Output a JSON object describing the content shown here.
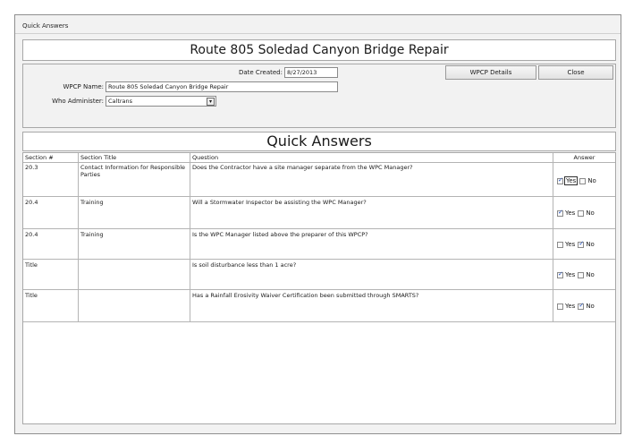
{
  "window": {
    "title": "Quick Answers"
  },
  "header": {
    "project_title": "Route 805 Soledad Canyon Bridge Repair"
  },
  "form": {
    "date_created_label": "Date Created:",
    "date_created_value": "8/27/2013",
    "wpcp_name_label": "WPCP Name:",
    "wpcp_name_value": "Route 805 Soledad Canyon Bridge Repair",
    "who_administer_label": "Who Administer:",
    "who_administer_value": "Caltrans",
    "wpcp_details_button": "WPCP Details",
    "close_button": "Close"
  },
  "section_title": "Quick Answers",
  "table": {
    "headers": {
      "section": "Section #",
      "title": "Section Title",
      "question": "Question",
      "answer": "Answer"
    },
    "yes_label": "Yes",
    "no_label": "No",
    "rows": [
      {
        "section": "20.3",
        "title": "Contact Information for Responsible Parties",
        "question": "Does the Contractor have a site manager separate from the WPC Manager?",
        "yes": true,
        "no": false
      },
      {
        "section": "20.4",
        "title": "Training",
        "question": "Will a Stormwater Inspector be assisting the WPC Manager?",
        "yes": true,
        "no": false
      },
      {
        "section": "20.4",
        "title": "Training",
        "question": "Is the WPC Manager listed above the preparer of this WPCP?",
        "yes": false,
        "no": true
      },
      {
        "section": "Title",
        "title": "",
        "question": "Is soil disturbance less than 1 acre?",
        "yes": true,
        "no": false
      },
      {
        "section": "Title",
        "title": "",
        "question": "Has a Rainfall Erosivity Waiver Certification been submitted through SMARTS?",
        "yes": false,
        "no": true
      }
    ]
  },
  "icons": {
    "dropdown": "chevron-down-icon",
    "check": "checkmark-icon"
  }
}
